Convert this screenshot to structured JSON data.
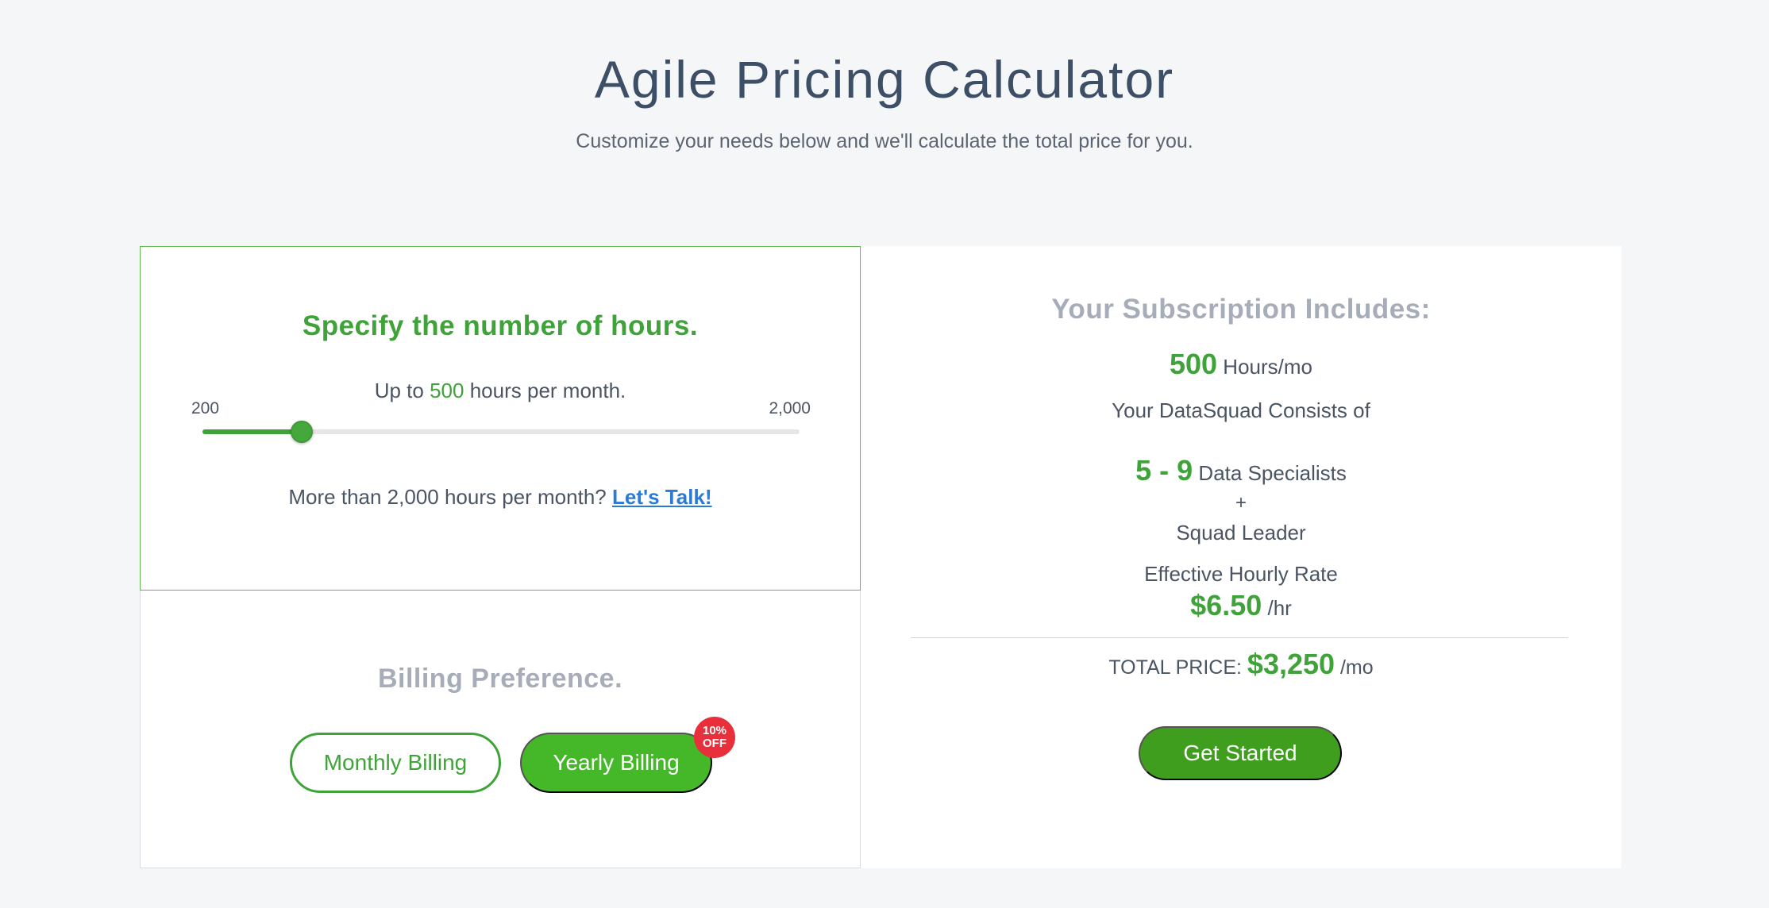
{
  "header": {
    "title": "Agile Pricing Calculator",
    "subtitle": "Customize your needs below and we'll calculate the total price for you."
  },
  "hours": {
    "title": "Specify the number of hours.",
    "prefix": "Up to",
    "value": "500",
    "suffix": "hours per month.",
    "min_label": "200",
    "max_label": "2,000",
    "slider": {
      "min": 200,
      "max": 2000,
      "value": 500
    },
    "talk_prefix": "More than 2,000 hours per month?",
    "talk_link": "Let's Talk!"
  },
  "billing": {
    "title": "Billing Preference.",
    "monthly_label": "Monthly Billing",
    "yearly_label": "Yearly Billing",
    "badge": "10% OFF",
    "selected": "yearly"
  },
  "summary": {
    "title": "Your Subscription Includes:",
    "hours_value": "500",
    "hours_unit": "Hours/mo",
    "squad_label": "Your DataSquad Consists of",
    "specialists_value": "5 - 9",
    "specialists_label": "Data Specialists",
    "plus": "+",
    "leader_label": "Squad Leader",
    "rate_label": "Effective Hourly Rate",
    "rate_value": "$6.50",
    "rate_unit": "/hr",
    "total_label": "TOTAL PRICE:",
    "total_value": "$3,250",
    "total_unit": "/mo",
    "cta": "Get Started"
  },
  "colors": {
    "accent_green": "#3fa33a",
    "button_green": "#45b82a",
    "link_blue": "#2a7ad6",
    "badge_red": "#e8303c",
    "muted_title": "#a7adb8"
  }
}
